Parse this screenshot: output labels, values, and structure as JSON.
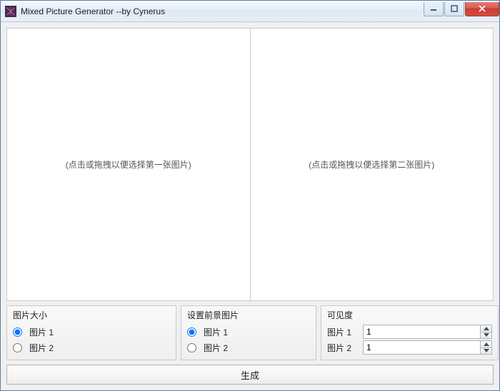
{
  "window": {
    "title": "Mixed Picture Generator    --by Cynerus"
  },
  "dropzones": {
    "left_hint": "(点击或拖拽以便选择第一张图片)",
    "right_hint": "(点击或拖拽以便选择第二张图片)"
  },
  "groups": {
    "size": {
      "title": "图片大小",
      "opt1": "图片 1",
      "opt2": "图片 2",
      "selected": "opt1"
    },
    "foreground": {
      "title": "设置前景图片",
      "opt1": "图片 1",
      "opt2": "图片 2",
      "selected": "opt1"
    },
    "visibility": {
      "title": "可见度",
      "row1_label": "图片 1",
      "row1_value": "1",
      "row2_label": "图片 2",
      "row2_value": "1"
    }
  },
  "generate_label": "生成"
}
